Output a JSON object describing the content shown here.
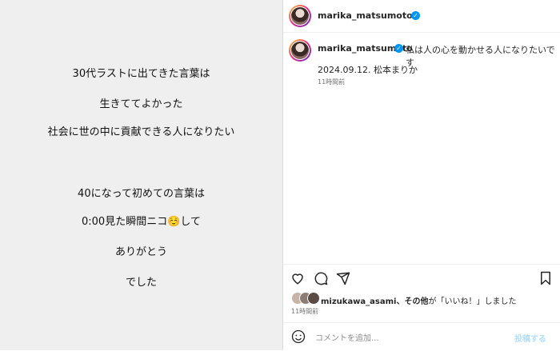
{
  "post_image": {
    "lines": [
      "30代ラストに出てきた言葉は",
      "生きててよかった",
      "社会に世の中に貢献できる人になりたい",
      "40になって初めての言葉は",
      "0:00見た瞬間ニコ☺️して",
      "ありがとう",
      "でした"
    ]
  },
  "header": {
    "username": "marika_matsumoto",
    "verified_glyph": "✓"
  },
  "caption": {
    "username": "marika_matsumoto",
    "text": "私は人の心を動かせる人になりたいです",
    "line2": "2024.09.12. 松本まりか",
    "time": "11時間前"
  },
  "actions": {
    "like_icon": "heart-icon",
    "comment_icon": "comment-icon",
    "share_icon": "send-icon",
    "save_icon": "bookmark-icon"
  },
  "likes": {
    "user": "mizukawa_asami",
    "rest": "、その他",
    "suffix": "が「いいね！」しました",
    "time": "11時間前"
  },
  "comment": {
    "placeholder": "コメントを追加...",
    "post_label": "投稿する",
    "emoji_icon": "smiley-icon"
  },
  "colors": {
    "accent": "#0095f6",
    "left_bg": "#efefef",
    "muted": "#737373"
  }
}
